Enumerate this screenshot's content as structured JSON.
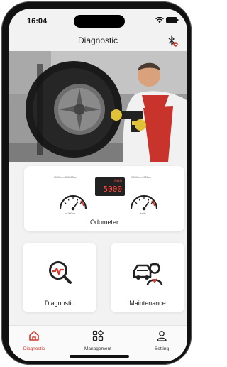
{
  "status_bar": {
    "time": "16:04"
  },
  "header": {
    "title": "Diagnostic"
  },
  "odometer_card": {
    "label": "Odometer",
    "left_gauge_scale": "3000km↔300000km",
    "right_gauge_scale": "2000Km↔2000km",
    "left_gauge_unit": "x1000km",
    "right_gauge_unit": "km/h",
    "display_top": "000",
    "display_value": "5000"
  },
  "tiles": {
    "diagnostic_label": "Diagnostic",
    "maintenance_label": "Maintenance"
  },
  "tabbar": {
    "items": [
      {
        "label": "Diagnostic",
        "active": true,
        "icon": "home-icon"
      },
      {
        "label": "Management",
        "active": false,
        "icon": "grid-icon"
      },
      {
        "label": "Setting",
        "active": false,
        "icon": "person-icon"
      }
    ]
  },
  "colors": {
    "accent": "#d23b30",
    "background": "#f2f2f2"
  }
}
